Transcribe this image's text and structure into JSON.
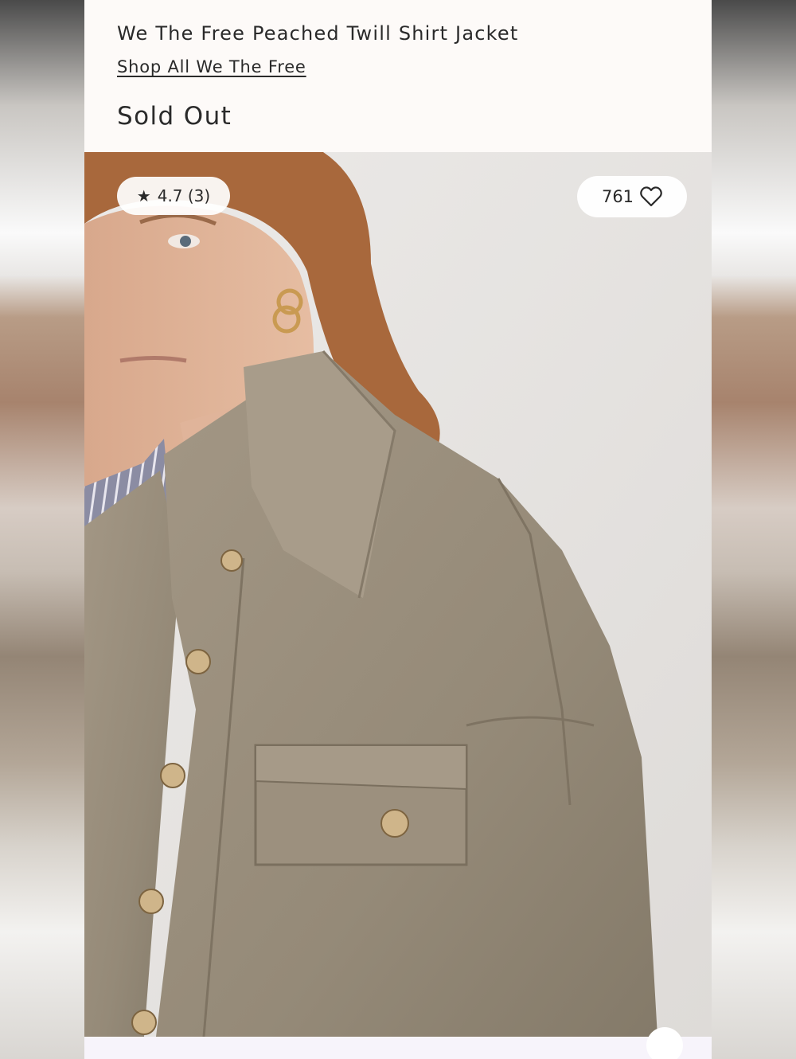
{
  "product": {
    "title": "We The Free Peached Twill Shirt Jacket",
    "brand_link": "Shop All We The Free",
    "availability": "Sold Out"
  },
  "badges": {
    "rating_star": "★",
    "rating_text": "4.7 (3)",
    "likes_count": "761",
    "heart_icon": "heart-outline-icon"
  },
  "colors": {
    "panel_background": "#fdfaf8",
    "text": "#2a2a2a",
    "jacket": "#9a8f7e",
    "shirt_stripe": "#8f90a6"
  }
}
